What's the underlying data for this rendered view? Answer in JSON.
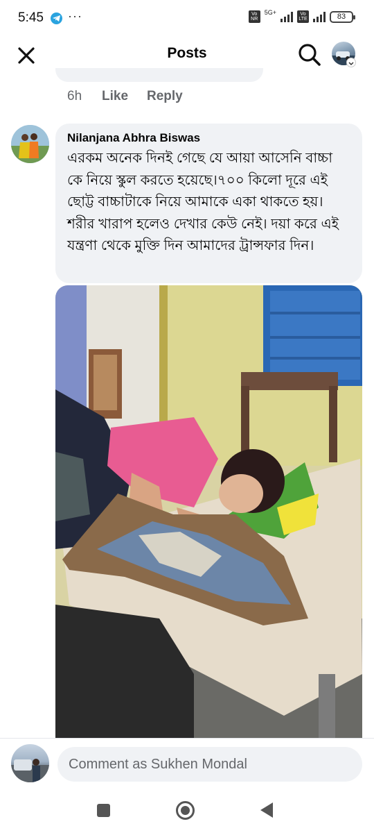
{
  "status_bar": {
    "time": "5:45",
    "more": "···",
    "net1": "Vo NR",
    "net1_label": "5G+",
    "net2": "Vo LTE",
    "battery": "83"
  },
  "header": {
    "title": "Posts",
    "close_icon": "close-icon",
    "search_icon": "search-icon"
  },
  "previous_comment": {
    "time": "6h",
    "like_label": "Like",
    "reply_label": "Reply"
  },
  "comment": {
    "author": "Nilanjana Abhra Biswas",
    "text": "এরকম অনেক দিনই গেছে যে আয়া আসেনি বাচ্চা কে নিয়ে স্কুল করতে হয়েছে।৭০০ কিলো দূরে এই ছোট্ট বাচ্চাটাকে নিয়ে আমাকে একা থাকতে হয়। শরীর খারাপ হলেও দেখার কেউ নেই। দয়া করে এই যন্ত্রণা থেকে মুক্তি দিন আমাদের ট্রান্সফার  দিন।"
  },
  "composer": {
    "placeholder": "Comment as Sukhen Mondal"
  },
  "colors": {
    "bubble": "#f0f2f5",
    "muted_text": "#65676b",
    "telegram": "#2aa3df"
  }
}
